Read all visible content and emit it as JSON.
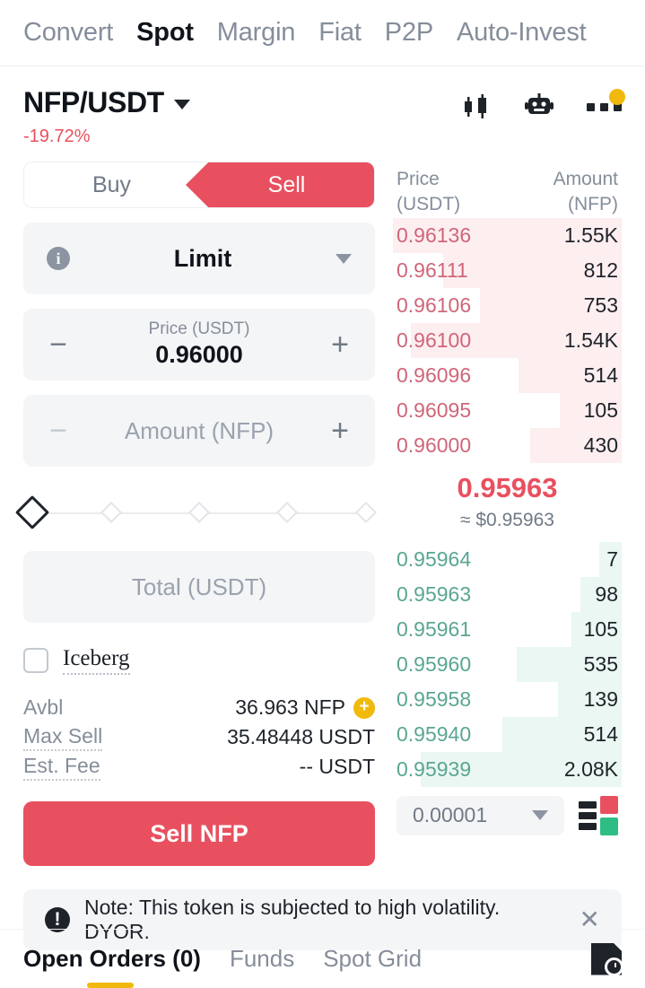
{
  "topnav": {
    "items": [
      {
        "label": "Convert",
        "active": false
      },
      {
        "label": "Spot",
        "active": true
      },
      {
        "label": "Margin",
        "active": false
      },
      {
        "label": "Fiat",
        "active": false
      },
      {
        "label": "P2P",
        "active": false
      },
      {
        "label": "Auto-Invest",
        "active": false
      }
    ]
  },
  "pair": {
    "name": "NFP/USDT",
    "change": "-19.72%",
    "change_color": "#e8505f",
    "icons": [
      "candlestick-icon",
      "bot-icon",
      "more-menu-icon"
    ]
  },
  "order_form": {
    "side_buy": "Buy",
    "side_sell": "Sell",
    "active_side": "Sell",
    "order_type": "Limit",
    "price_label": "Price (USDT)",
    "price_value": "0.96000",
    "amount_placeholder": "Amount (NFP)",
    "total_placeholder": "Total (USDT)",
    "minus": "−",
    "plus": "+",
    "info": "i",
    "iceberg_label": "Iceberg",
    "slider_percent": 0,
    "balances": [
      {
        "key": "Avbl",
        "value": "36.963 NFP",
        "has_plus_icon": true
      },
      {
        "key": "Max Sell",
        "value": "35.48448 USDT",
        "has_plus_icon": false
      },
      {
        "key": "Est. Fee",
        "value": "-- USDT",
        "has_plus_icon": false
      }
    ],
    "submit_label": "Sell NFP",
    "submit_color": "#e8505f"
  },
  "orderbook": {
    "head_price": "Price",
    "head_price_unit": "(USDT)",
    "head_amount": "Amount",
    "head_amount_unit": "(NFP)",
    "ask_color": "#cf6679",
    "bid_color": "#5aa693",
    "asks": [
      {
        "price": "0.96136",
        "amount": "1.55K",
        "depth": 100
      },
      {
        "price": "0.96111",
        "amount": "812",
        "depth": 78
      },
      {
        "price": "0.96106",
        "amount": "753",
        "depth": 62
      },
      {
        "price": "0.96100",
        "amount": "1.54K",
        "depth": 92
      },
      {
        "price": "0.96096",
        "amount": "514",
        "depth": 45
      },
      {
        "price": "0.96095",
        "amount": "105",
        "depth": 27
      },
      {
        "price": "0.96000",
        "amount": "430",
        "depth": 40
      }
    ],
    "mid_price": "0.95963",
    "mid_usd": "≈ $0.95963",
    "bids": [
      {
        "price": "0.95964",
        "amount": "7",
        "depth": 10
      },
      {
        "price": "0.95963",
        "amount": "98",
        "depth": 18
      },
      {
        "price": "0.95961",
        "amount": "105",
        "depth": 22
      },
      {
        "price": "0.95960",
        "amount": "535",
        "depth": 46
      },
      {
        "price": "0.95958",
        "amount": "139",
        "depth": 28
      },
      {
        "price": "0.95940",
        "amount": "514",
        "depth": 52
      },
      {
        "price": "0.95939",
        "amount": "2.08K",
        "depth": 88
      }
    ],
    "tick_size": "0.00001"
  },
  "note": {
    "text": "Note: This token is subjected to high volatility. DYOR.",
    "close": "✕"
  },
  "bottom_tabs": {
    "items": [
      {
        "label": "Open Orders (0)",
        "active": true
      },
      {
        "label": "Funds",
        "active": false
      },
      {
        "label": "Spot Grid",
        "active": false
      }
    ],
    "indicator_color": "#f0b90b"
  }
}
